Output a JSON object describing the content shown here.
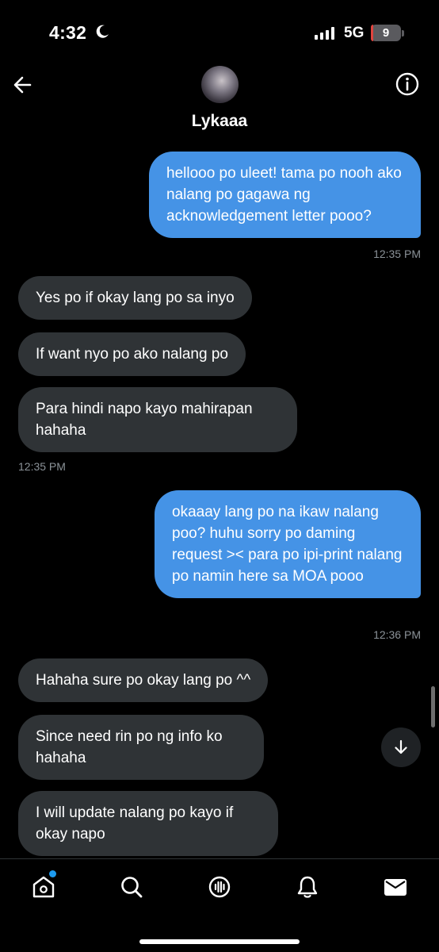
{
  "status_bar": {
    "time": "4:32",
    "network": "5G",
    "battery": "9",
    "battery_fraction": 0.09,
    "icons": [
      "moon-icon",
      "signal-icon",
      "battery-icon"
    ]
  },
  "header": {
    "contact_name": "Lykaaa",
    "icons": [
      "back-arrow-icon",
      "info-icon"
    ]
  },
  "messages": [
    {
      "direction": "sent",
      "text": "hellooo po uleet! tama po nooh ako nalang po gagawa ng acknowledgement letter pooo?"
    },
    {
      "timestamp": "12:35 PM"
    },
    {
      "direction": "received",
      "text": "Yes po if okay lang po sa inyo"
    },
    {
      "direction": "received",
      "text": "If want nyo po ako nalang po"
    },
    {
      "direction": "received",
      "text": "Para hindi napo kayo mahirapan hahaha"
    },
    {
      "timestamp": "12:35 PM"
    },
    {
      "direction": "sent",
      "text": "okaaay lang po na ikaw nalang poo? huhu sorry po daming request >< para po ipi-print nalang po namin here sa MOA pooo"
    },
    {
      "timestamp": "12:36 PM"
    },
    {
      "direction": "received",
      "text": "Hahaha sure po okay lang po ^^"
    },
    {
      "direction": "received",
      "text": "Since need rin po ng info ko hahaha"
    },
    {
      "direction": "received",
      "text": "I will update nalang po kayo if okay napo"
    }
  ],
  "bottom_nav": {
    "items": [
      "home-icon",
      "search-icon",
      "spaces-icon",
      "bell-icon",
      "mail-icon"
    ],
    "active": "home-icon",
    "accent": "#1d9bf0"
  },
  "colors": {
    "sent_bubble": "#4593e6",
    "received_bubble": "#2f3336",
    "background": "#000000",
    "timestamp": "#8b9298"
  }
}
